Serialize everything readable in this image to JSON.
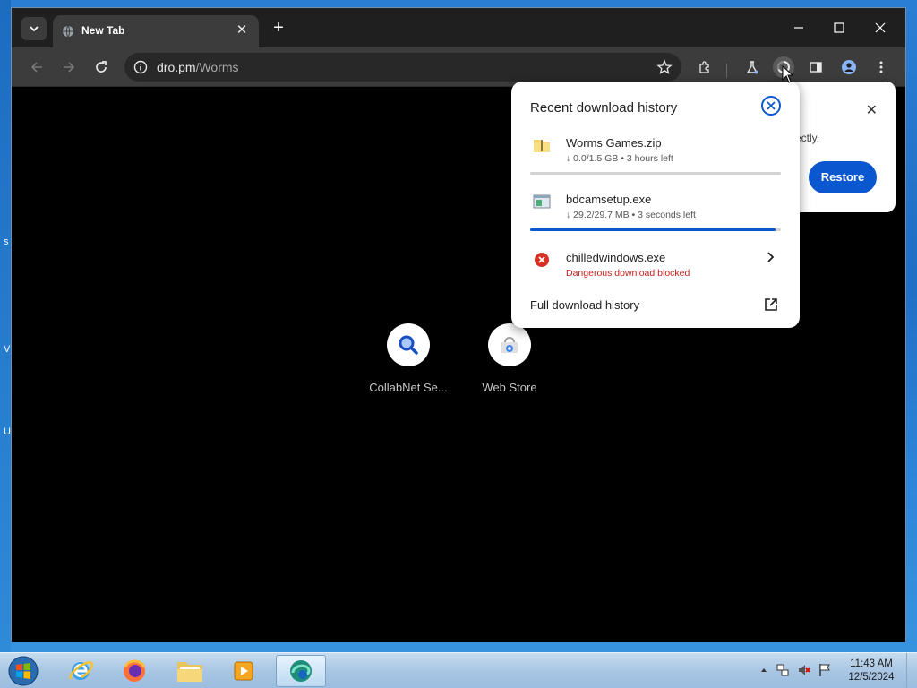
{
  "desktop": {
    "edge_glyphs": [
      "s",
      "V",
      "U"
    ]
  },
  "tab": {
    "title": "New Tab",
    "close": "✕"
  },
  "new_tab": "+",
  "omnibox": {
    "host": "dro.pm",
    "path": "/Worms"
  },
  "shortcuts": [
    {
      "label": "CollabNet Se...",
      "icon": "search-icon"
    },
    {
      "label": "Web Store",
      "icon": "web-store-icon"
    }
  ],
  "restore_bubble": {
    "text_fragment": "ectly.",
    "button": "Restore",
    "close": "✕"
  },
  "downloads": {
    "title": "Recent download history",
    "items": [
      {
        "name": "Worms Games.zip",
        "status": "↓ 0.0/1.5 GB • 3 hours left",
        "progress": 0.0,
        "icon": "zip-folder-icon"
      },
      {
        "name": "bdcamsetup.exe",
        "status": "↓ 29.2/29.7 MB • 3 seconds left",
        "progress": 0.98,
        "icon": "exe-file-icon"
      },
      {
        "name": "chilledwindows.exe",
        "status": "Dangerous download blocked",
        "icon": "blocked-icon"
      }
    ],
    "full_history": "Full download history"
  },
  "colors": {
    "accent": "#0b57d0",
    "danger": "#c5221f",
    "progress_track": "#d3d3d3"
  },
  "clock": {
    "time": "11:43 AM",
    "date": "12/5/2024"
  }
}
